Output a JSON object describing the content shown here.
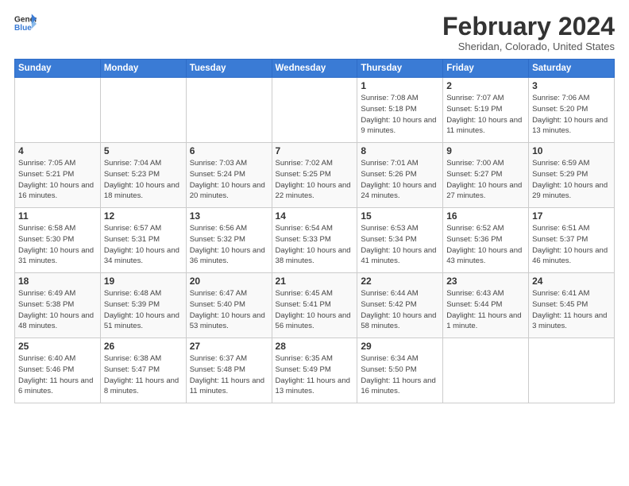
{
  "header": {
    "logo_line1": "General",
    "logo_line2": "Blue",
    "month": "February 2024",
    "location": "Sheridan, Colorado, United States"
  },
  "weekdays": [
    "Sunday",
    "Monday",
    "Tuesday",
    "Wednesday",
    "Thursday",
    "Friday",
    "Saturday"
  ],
  "weeks": [
    [
      {
        "day": "",
        "info": ""
      },
      {
        "day": "",
        "info": ""
      },
      {
        "day": "",
        "info": ""
      },
      {
        "day": "",
        "info": ""
      },
      {
        "day": "1",
        "info": "Sunrise: 7:08 AM\nSunset: 5:18 PM\nDaylight: 10 hours\nand 9 minutes."
      },
      {
        "day": "2",
        "info": "Sunrise: 7:07 AM\nSunset: 5:19 PM\nDaylight: 10 hours\nand 11 minutes."
      },
      {
        "day": "3",
        "info": "Sunrise: 7:06 AM\nSunset: 5:20 PM\nDaylight: 10 hours\nand 13 minutes."
      }
    ],
    [
      {
        "day": "4",
        "info": "Sunrise: 7:05 AM\nSunset: 5:21 PM\nDaylight: 10 hours\nand 16 minutes."
      },
      {
        "day": "5",
        "info": "Sunrise: 7:04 AM\nSunset: 5:23 PM\nDaylight: 10 hours\nand 18 minutes."
      },
      {
        "day": "6",
        "info": "Sunrise: 7:03 AM\nSunset: 5:24 PM\nDaylight: 10 hours\nand 20 minutes."
      },
      {
        "day": "7",
        "info": "Sunrise: 7:02 AM\nSunset: 5:25 PM\nDaylight: 10 hours\nand 22 minutes."
      },
      {
        "day": "8",
        "info": "Sunrise: 7:01 AM\nSunset: 5:26 PM\nDaylight: 10 hours\nand 24 minutes."
      },
      {
        "day": "9",
        "info": "Sunrise: 7:00 AM\nSunset: 5:27 PM\nDaylight: 10 hours\nand 27 minutes."
      },
      {
        "day": "10",
        "info": "Sunrise: 6:59 AM\nSunset: 5:29 PM\nDaylight: 10 hours\nand 29 minutes."
      }
    ],
    [
      {
        "day": "11",
        "info": "Sunrise: 6:58 AM\nSunset: 5:30 PM\nDaylight: 10 hours\nand 31 minutes."
      },
      {
        "day": "12",
        "info": "Sunrise: 6:57 AM\nSunset: 5:31 PM\nDaylight: 10 hours\nand 34 minutes."
      },
      {
        "day": "13",
        "info": "Sunrise: 6:56 AM\nSunset: 5:32 PM\nDaylight: 10 hours\nand 36 minutes."
      },
      {
        "day": "14",
        "info": "Sunrise: 6:54 AM\nSunset: 5:33 PM\nDaylight: 10 hours\nand 38 minutes."
      },
      {
        "day": "15",
        "info": "Sunrise: 6:53 AM\nSunset: 5:34 PM\nDaylight: 10 hours\nand 41 minutes."
      },
      {
        "day": "16",
        "info": "Sunrise: 6:52 AM\nSunset: 5:36 PM\nDaylight: 10 hours\nand 43 minutes."
      },
      {
        "day": "17",
        "info": "Sunrise: 6:51 AM\nSunset: 5:37 PM\nDaylight: 10 hours\nand 46 minutes."
      }
    ],
    [
      {
        "day": "18",
        "info": "Sunrise: 6:49 AM\nSunset: 5:38 PM\nDaylight: 10 hours\nand 48 minutes."
      },
      {
        "day": "19",
        "info": "Sunrise: 6:48 AM\nSunset: 5:39 PM\nDaylight: 10 hours\nand 51 minutes."
      },
      {
        "day": "20",
        "info": "Sunrise: 6:47 AM\nSunset: 5:40 PM\nDaylight: 10 hours\nand 53 minutes."
      },
      {
        "day": "21",
        "info": "Sunrise: 6:45 AM\nSunset: 5:41 PM\nDaylight: 10 hours\nand 56 minutes."
      },
      {
        "day": "22",
        "info": "Sunrise: 6:44 AM\nSunset: 5:42 PM\nDaylight: 10 hours\nand 58 minutes."
      },
      {
        "day": "23",
        "info": "Sunrise: 6:43 AM\nSunset: 5:44 PM\nDaylight: 11 hours\nand 1 minute."
      },
      {
        "day": "24",
        "info": "Sunrise: 6:41 AM\nSunset: 5:45 PM\nDaylight: 11 hours\nand 3 minutes."
      }
    ],
    [
      {
        "day": "25",
        "info": "Sunrise: 6:40 AM\nSunset: 5:46 PM\nDaylight: 11 hours\nand 6 minutes."
      },
      {
        "day": "26",
        "info": "Sunrise: 6:38 AM\nSunset: 5:47 PM\nDaylight: 11 hours\nand 8 minutes."
      },
      {
        "day": "27",
        "info": "Sunrise: 6:37 AM\nSunset: 5:48 PM\nDaylight: 11 hours\nand 11 minutes."
      },
      {
        "day": "28",
        "info": "Sunrise: 6:35 AM\nSunset: 5:49 PM\nDaylight: 11 hours\nand 13 minutes."
      },
      {
        "day": "29",
        "info": "Sunrise: 6:34 AM\nSunset: 5:50 PM\nDaylight: 11 hours\nand 16 minutes."
      },
      {
        "day": "",
        "info": ""
      },
      {
        "day": "",
        "info": ""
      }
    ]
  ]
}
